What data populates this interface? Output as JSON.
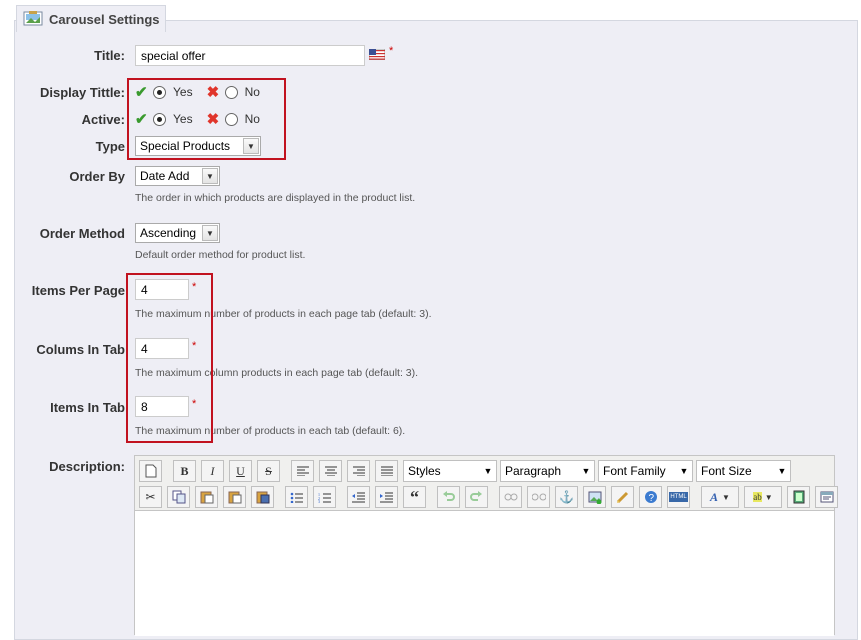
{
  "section": {
    "title": "Carousel Settings",
    "icon": "carousel-settings-icon"
  },
  "fields": {
    "title": {
      "label": "Title:",
      "value": "special offer",
      "required_mark": "*",
      "flag_icon": "us-flag-icon"
    },
    "display_title": {
      "label": "Display Tittle:",
      "yes": "Yes",
      "no": "No",
      "selected": "Yes"
    },
    "active": {
      "label": "Active:",
      "yes": "Yes",
      "no": "No",
      "selected": "Yes"
    },
    "type": {
      "label": "Type",
      "value": "Special Products"
    },
    "order_by": {
      "label": "Order By",
      "value": "Date Add",
      "hint": "The order in which products are displayed in the product list."
    },
    "order_method": {
      "label": "Order Method",
      "value": "Ascending",
      "hint": "Default order method for product list."
    },
    "items_per_page": {
      "label": "Items Per Page",
      "value": "4",
      "required_mark": "*",
      "hint": "The maximum number of products in each page tab (default: 3)."
    },
    "columns_in_tab": {
      "label": "Colums In Tab",
      "value": "4",
      "required_mark": "*",
      "hint": "The maximum column products in each page tab (default: 3)."
    },
    "items_in_tab": {
      "label": "Items In Tab",
      "value": "8",
      "required_mark": "*",
      "hint": "The maximum number of products in each tab (default: 6)."
    },
    "description": {
      "label": "Description:"
    }
  },
  "editor": {
    "styles": "Styles",
    "paragraph": "Paragraph",
    "font_family": "Font Family",
    "font_size": "Font Size",
    "bold": "B",
    "italic": "I",
    "underline": "U",
    "strike": "S",
    "blockquote": "“",
    "html": "HTML"
  },
  "colors": {
    "highlight_box": "#c1121f",
    "panel_bg": "#eeeef5",
    "required": "#cc0000"
  }
}
